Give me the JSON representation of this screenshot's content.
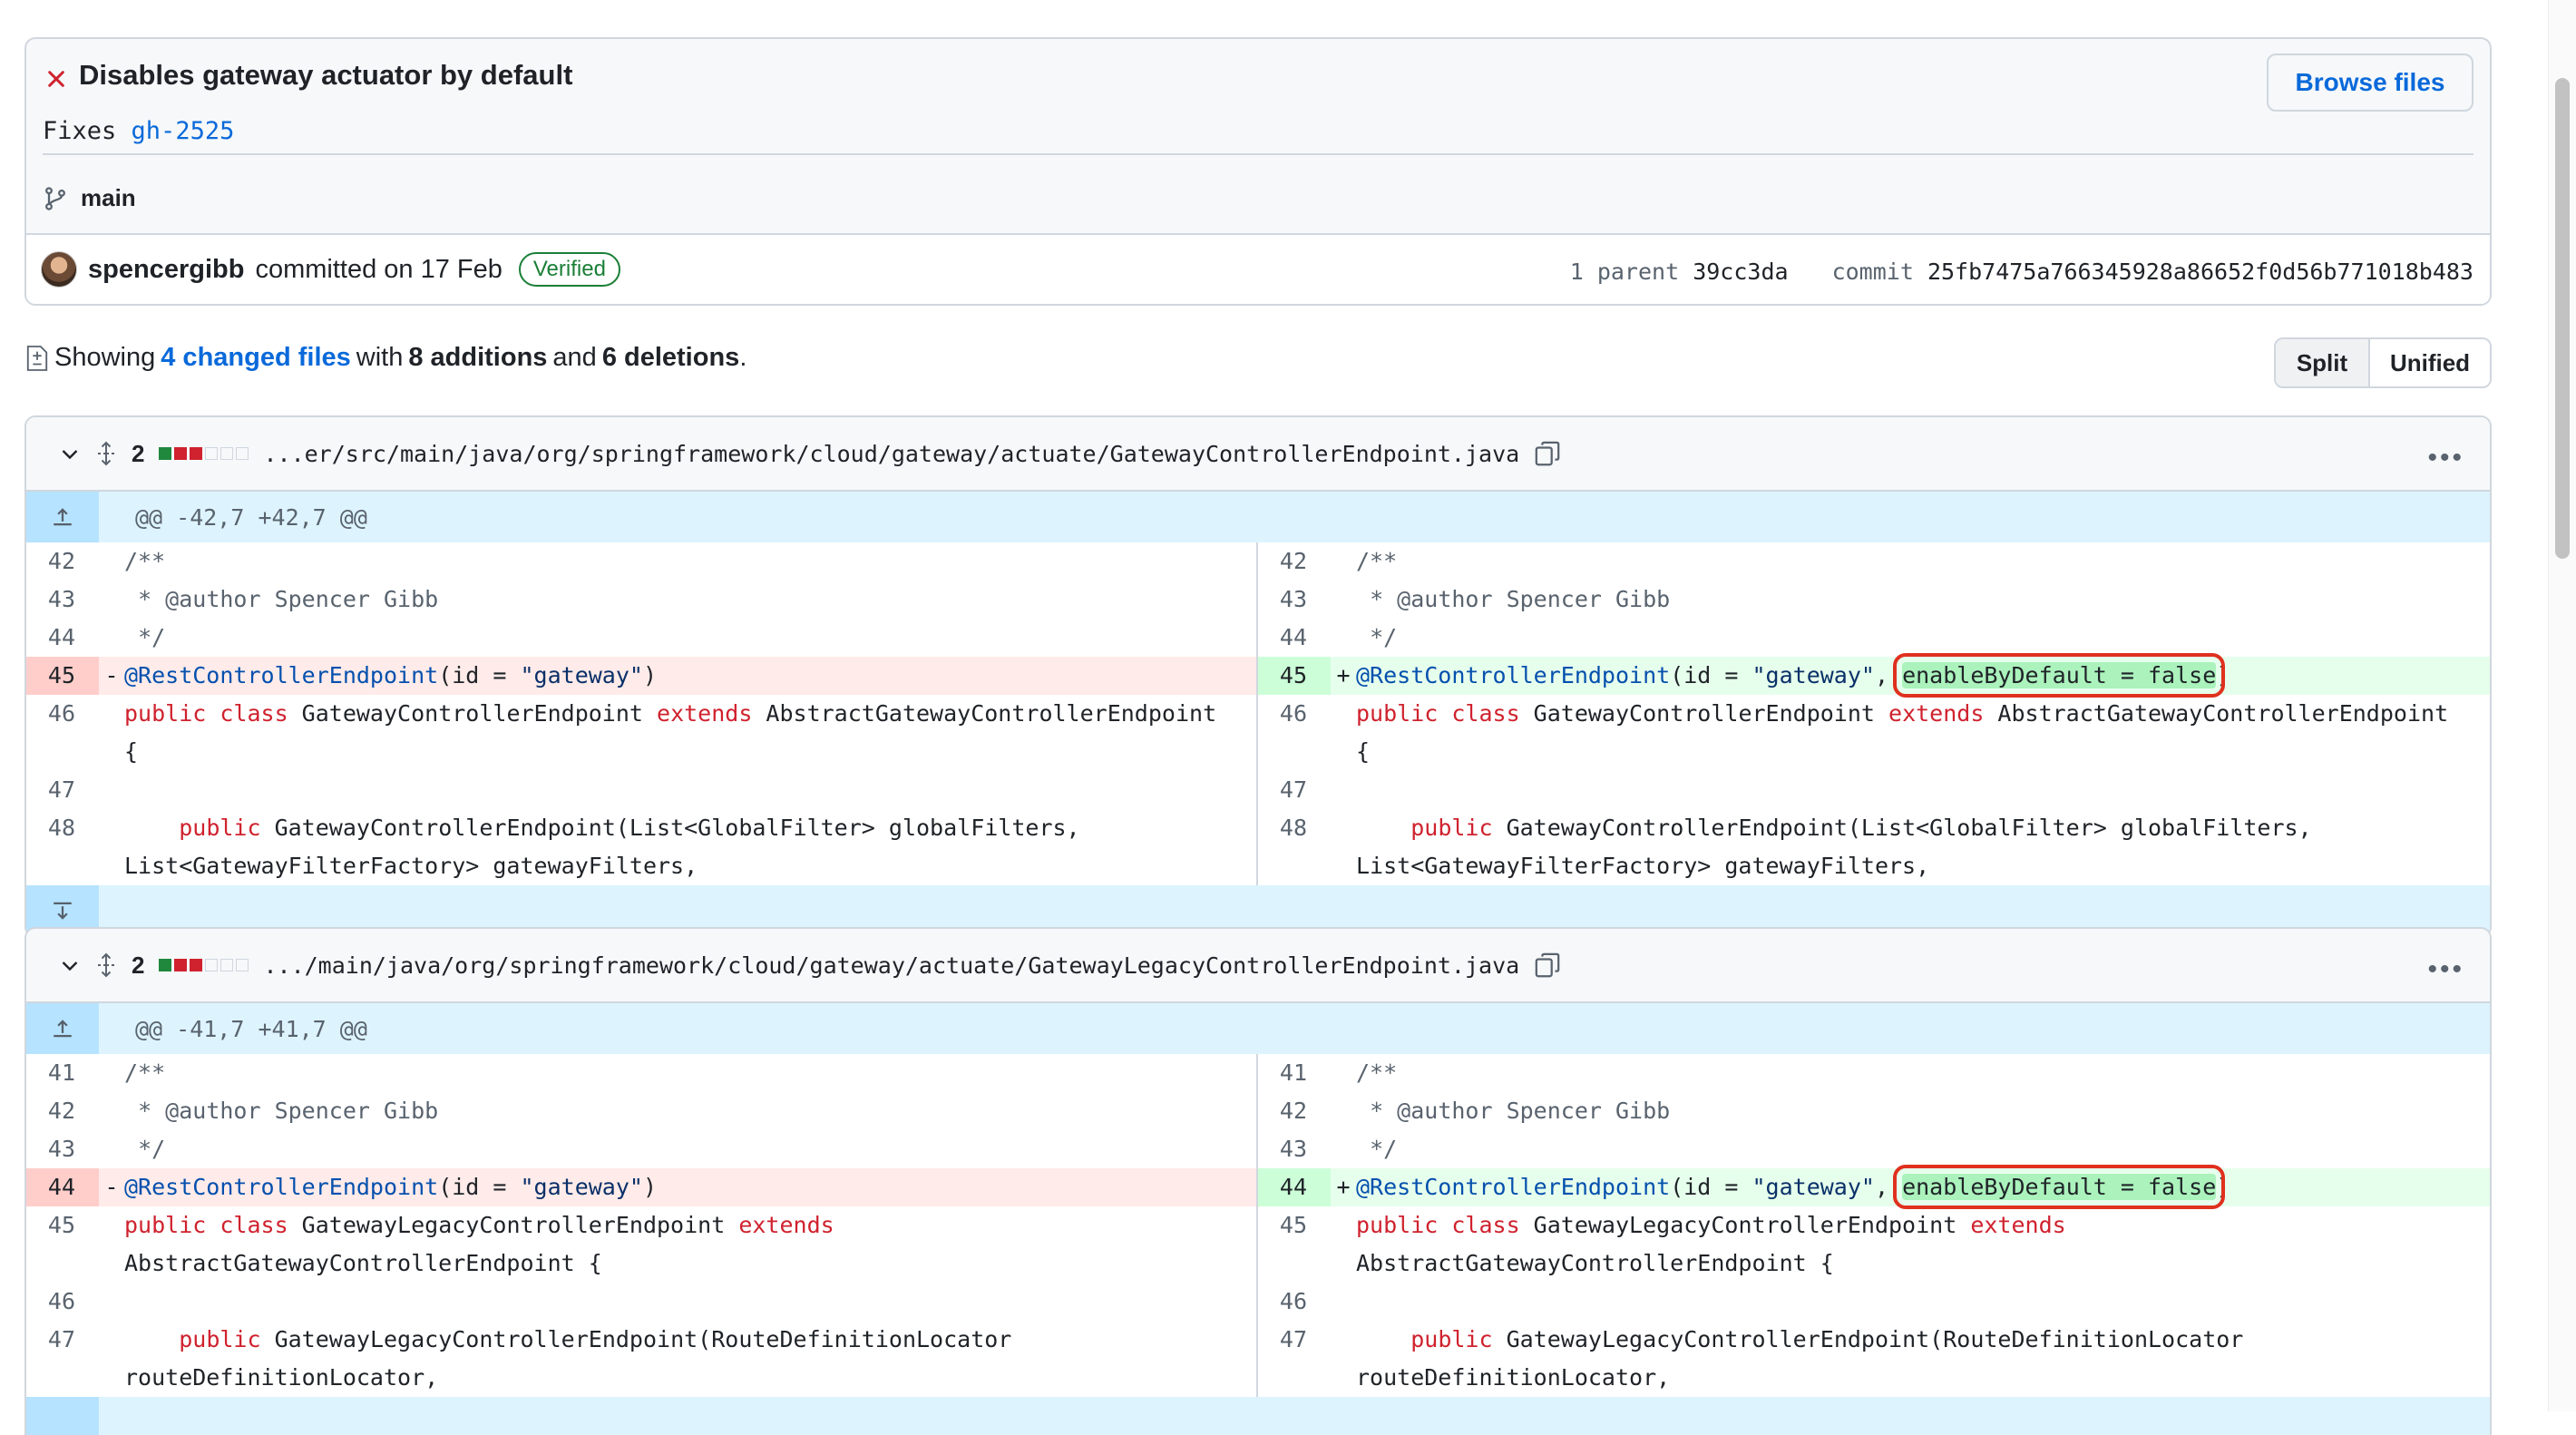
{
  "commit": {
    "status": "failed",
    "title": "Disables gateway actuator by default",
    "desc_prefix": "Fixes ",
    "desc_link": "gh-2525",
    "browse_label": "Browse files",
    "branch": "main",
    "author": "spencergibb",
    "committed_text": "committed on 17 Feb",
    "verified": "Verified",
    "parent_label": "1 parent",
    "parent_sha": "39cc3da",
    "commit_label": "commit",
    "commit_sha": "25fb7475a766345928a86652f0d56b771018b483"
  },
  "summary": {
    "showing": "Showing",
    "changed_files": "4 changed files",
    "with": "with",
    "additions": "8 additions",
    "and": "and",
    "deletions": "6 deletions",
    "period": "."
  },
  "view_toggle": {
    "split": "Split",
    "unified": "Unified",
    "active": "split"
  },
  "colors": {
    "accent": "#0969da",
    "added": "#1f883d",
    "deleted": "#cf222e",
    "highlight_box": "#e0301e"
  },
  "files": [
    {
      "change_count": "2",
      "path": "...er/src/main/java/org/springframework/cloud/gateway/actuate/GatewayControllerEndpoint.java",
      "hunk": "@@ -42,7 +42,7 @@",
      "left": [
        {
          "n": "42",
          "text": "/**"
        },
        {
          "n": "43",
          "text": " * @author Spencer Gibb"
        },
        {
          "n": "44",
          "text": " */"
        },
        {
          "n": "45",
          "text": "- @RestControllerEndpoint(id = \"gateway\")"
        },
        {
          "n": "46",
          "text": "public class GatewayControllerEndpoint extends AbstractGatewayControllerEndpoint {"
        },
        {
          "n": "47",
          "text": ""
        },
        {
          "n": "48",
          "text": "    public GatewayControllerEndpoint(List<GlobalFilter> globalFilters, List<GatewayFilterFactory> gatewayFilters,"
        }
      ],
      "right": [
        {
          "n": "42",
          "text": "/**"
        },
        {
          "n": "43",
          "text": " * @author Spencer Gibb"
        },
        {
          "n": "44",
          "text": " */"
        },
        {
          "n": "45",
          "text": "+ @RestControllerEndpoint(id = \"gateway\", enableByDefault = false)"
        },
        {
          "n": "46",
          "text": "public class GatewayControllerEndpoint extends AbstractGatewayControllerEndpoint {"
        },
        {
          "n": "47",
          "text": ""
        },
        {
          "n": "48",
          "text": "    public GatewayControllerEndpoint(List<GlobalFilter> globalFilters, List<GatewayFilterFactory> gatewayFilters,"
        }
      ]
    },
    {
      "change_count": "2",
      "path": ".../main/java/org/springframework/cloud/gateway/actuate/GatewayLegacyControllerEndpoint.java",
      "hunk": "@@ -41,7 +41,7 @@",
      "left": [
        {
          "n": "41",
          "text": "/**"
        },
        {
          "n": "42",
          "text": " * @author Spencer Gibb"
        },
        {
          "n": "43",
          "text": " */"
        },
        {
          "n": "44",
          "text": "- @RestControllerEndpoint(id = \"gateway\")"
        },
        {
          "n": "45",
          "text": "public class GatewayLegacyControllerEndpoint extends AbstractGatewayControllerEndpoint {"
        },
        {
          "n": "46",
          "text": ""
        },
        {
          "n": "47",
          "text": "    public GatewayLegacyControllerEndpoint(RouteDefinitionLocator routeDefinitionLocator,"
        }
      ],
      "right": [
        {
          "n": "41",
          "text": "/**"
        },
        {
          "n": "42",
          "text": " * @author Spencer Gibb"
        },
        {
          "n": "43",
          "text": " */"
        },
        {
          "n": "44",
          "text": "+ @RestControllerEndpoint(id = \"gateway\", enableByDefault = false)"
        },
        {
          "n": "45",
          "text": "public class GatewayLegacyControllerEndpoint extends AbstractGatewayControllerEndpoint {"
        },
        {
          "n": "46",
          "text": ""
        },
        {
          "n": "47",
          "text": "    public GatewayLegacyControllerEndpoint(RouteDefinitionLocator routeDefinitionLocator,"
        }
      ]
    }
  ]
}
